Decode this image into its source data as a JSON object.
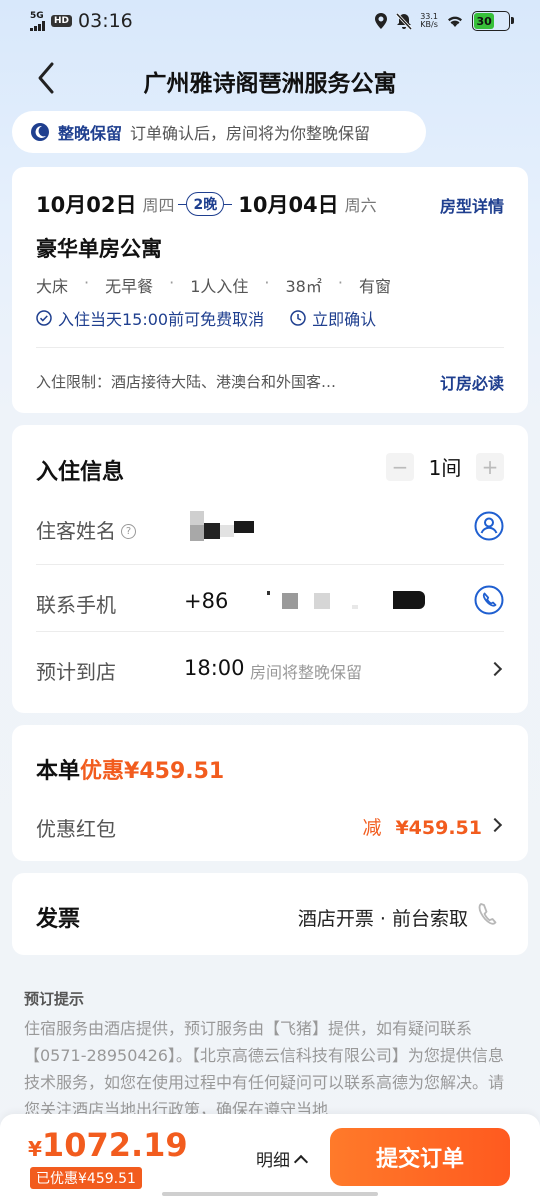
{
  "status_bar": {
    "network": "5G",
    "hd": "HD",
    "time": "03:16",
    "net_speed_value": "33.1",
    "net_speed_unit": "KB/s",
    "battery_level": "30"
  },
  "nav": {
    "title": "广州雅诗阁琶洲服务公寓"
  },
  "notice": {
    "strong": "整晚保留",
    "text": "订单确认后，房间将为你整晚保留"
  },
  "stay": {
    "checkin_date": "10月02日",
    "checkin_weekday": "周四",
    "nights": "2晚",
    "checkout_date": "10月04日",
    "checkout_weekday": "周六",
    "room_detail_link": "房型详情",
    "room_name": "豪华单房公寓",
    "specs": [
      "大床",
      "无早餐",
      "1人入住",
      "38㎡",
      "有窗"
    ],
    "policy_cancel": "入住当天15:00前可免费取消",
    "policy_confirm": "立即确认",
    "restriction": "入住限制：酒店接待大陆、港澳台和外国客…",
    "must_read": "订房必读"
  },
  "guest_info": {
    "title": "入住信息",
    "minus": "−",
    "room_count": "1间",
    "plus": "+",
    "name_label": "住客姓名",
    "help_glyph": "?",
    "phone_label": "联系手机",
    "phone_prefix": "+86",
    "arrival_label": "预计到店",
    "arrival_time": "18:00",
    "arrival_note": "房间将整晚保留"
  },
  "discount": {
    "title_prefix": "本单",
    "title_accent": "优惠¥459.51",
    "coupon_label": "优惠红包",
    "coupon_reduce": "减",
    "coupon_amount": "¥459.51"
  },
  "invoice": {
    "title": "发票",
    "value": "酒店开票 · 前台索取"
  },
  "tips": {
    "title": "预订提示",
    "body": "住宿服务由酒店提供，预订服务由【飞猪】提供，如有疑问联系【0571-28950426】。【北京高德云信科技有限公司】为您提供信息技术服务，如您在使用过程中有任何疑问可以联系高德为您解决。请您关注酒店当地出行政策，确保在遵守当地"
  },
  "bottom": {
    "currency": "¥",
    "total": "1072.19",
    "saved": "已优惠¥459.51",
    "detail": "明细",
    "submit": "提交订单"
  },
  "colors": {
    "brand_blue": "#1f3f8f",
    "accent_orange": "#f25c1e",
    "battery_green": "#37c03a"
  }
}
